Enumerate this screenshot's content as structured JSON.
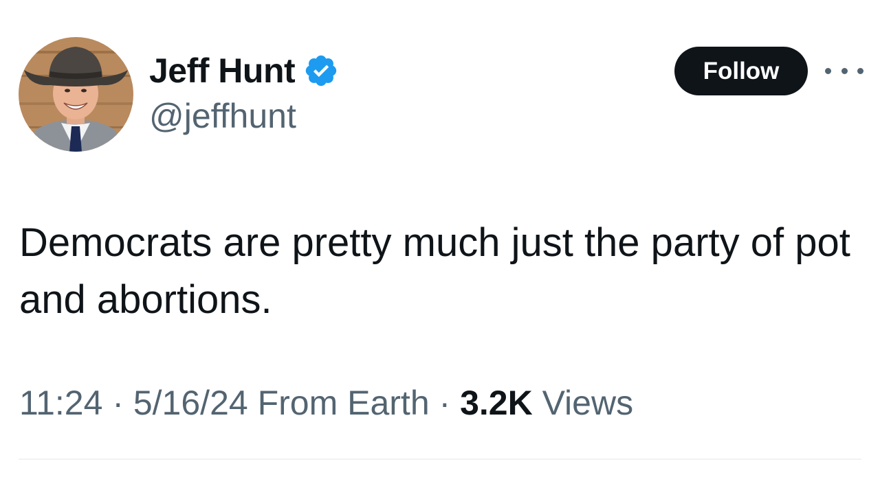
{
  "author": {
    "display_name": "Jeff Hunt",
    "handle": "@jeffhunt",
    "verified_icon": "verified-badge-icon",
    "verified_color": "#1d9bf0"
  },
  "actions": {
    "follow_label": "Follow",
    "more_icon": "more-options-icon"
  },
  "tweet": {
    "text": "Democrats are pretty much just the party of pot and abortions."
  },
  "meta": {
    "time": "11:24",
    "separator1": " · ",
    "date": "5/16/24",
    "source": " From Earth",
    "separator2": " · ",
    "views_count": "3.2K",
    "views_label": " Views"
  },
  "colors": {
    "text_primary": "#0f1419",
    "text_secondary": "#536471",
    "button_bg": "#0f1419",
    "divider": "#eff3f4"
  }
}
